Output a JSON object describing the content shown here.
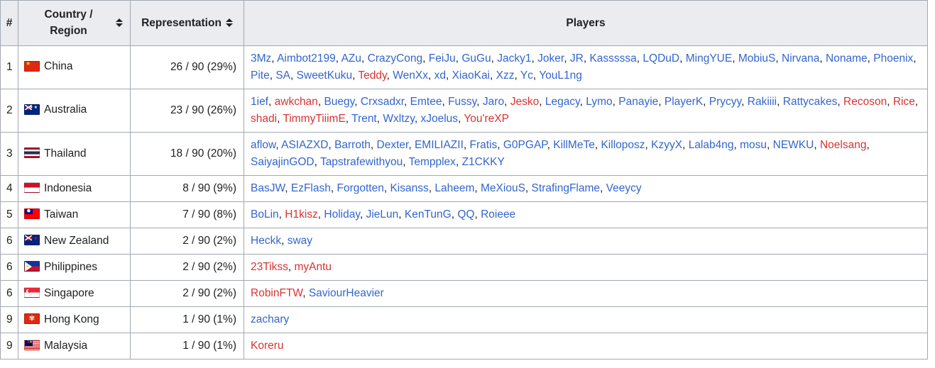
{
  "table": {
    "headers": [
      {
        "label": "#",
        "sortable": false,
        "name": "rank"
      },
      {
        "label": "Country / Region",
        "sortable": true,
        "name": "country-region"
      },
      {
        "label": "Representation",
        "sortable": true,
        "name": "representation"
      },
      {
        "label": "Players",
        "sortable": false,
        "name": "players"
      }
    ],
    "sort_icon": "sort-ascending-descending-icon",
    "colors": {
      "link_blue": "#3366cc",
      "link_red": "#d73333",
      "header_bg": "#eaecf0",
      "border": "#a2a9b1",
      "text": "#202122"
    },
    "rows": [
      {
        "rank": "1",
        "country": "China",
        "flag": "flag-china",
        "representation": "26 / 90 (29%)",
        "players": [
          {
            "name": "3Mz",
            "color": "blue"
          },
          {
            "name": "Aimbot2199",
            "color": "blue"
          },
          {
            "name": "AZu",
            "color": "blue"
          },
          {
            "name": "CrazyCong",
            "color": "blue"
          },
          {
            "name": "FeiJu",
            "color": "blue"
          },
          {
            "name": "GuGu",
            "color": "blue"
          },
          {
            "name": "Jacky1",
            "color": "blue"
          },
          {
            "name": "Joker",
            "color": "blue"
          },
          {
            "name": "JR",
            "color": "blue"
          },
          {
            "name": "Kasssssa",
            "color": "blue"
          },
          {
            "name": "LQDuD",
            "color": "blue"
          },
          {
            "name": "MingYUE",
            "color": "blue"
          },
          {
            "name": "MobiuS",
            "color": "blue"
          },
          {
            "name": "Nirvana",
            "color": "blue"
          },
          {
            "name": "Noname",
            "color": "blue"
          },
          {
            "name": "Phoenix",
            "color": "blue"
          },
          {
            "name": "Pite",
            "color": "blue"
          },
          {
            "name": "SA",
            "color": "blue"
          },
          {
            "name": "SweetKuku",
            "color": "blue"
          },
          {
            "name": "Teddy",
            "color": "red"
          },
          {
            "name": "WenXx",
            "color": "blue"
          },
          {
            "name": "xd",
            "color": "blue"
          },
          {
            "name": "XiaoKai",
            "color": "blue"
          },
          {
            "name": "Xzz",
            "color": "blue"
          },
          {
            "name": "Yc",
            "color": "blue"
          },
          {
            "name": "YouL1ng",
            "color": "blue"
          }
        ]
      },
      {
        "rank": "2",
        "country": "Australia",
        "flag": "flag-australia",
        "representation": "23 / 90 (26%)",
        "players": [
          {
            "name": "1ief",
            "color": "blue"
          },
          {
            "name": "awkchan",
            "color": "red"
          },
          {
            "name": "Buegy",
            "color": "blue"
          },
          {
            "name": "Crxsadxr",
            "color": "blue"
          },
          {
            "name": "Emtee",
            "color": "blue"
          },
          {
            "name": "Fussy",
            "color": "blue"
          },
          {
            "name": "Jaro",
            "color": "blue"
          },
          {
            "name": "Jesko",
            "color": "red"
          },
          {
            "name": "Legacy",
            "color": "blue"
          },
          {
            "name": "Lymo",
            "color": "blue"
          },
          {
            "name": "Panayie",
            "color": "blue"
          },
          {
            "name": "PlayerK",
            "color": "blue"
          },
          {
            "name": "Prycyy",
            "color": "blue"
          },
          {
            "name": "Rakiiii",
            "color": "blue"
          },
          {
            "name": "Rattycakes",
            "color": "blue"
          },
          {
            "name": "Recoson",
            "color": "red"
          },
          {
            "name": "Rice",
            "color": "red"
          },
          {
            "name": "shadi",
            "color": "red"
          },
          {
            "name": "TimmyTiiimE",
            "color": "red"
          },
          {
            "name": "Trent",
            "color": "blue"
          },
          {
            "name": "Wxltzy",
            "color": "blue"
          },
          {
            "name": "xJoelus",
            "color": "blue"
          },
          {
            "name": "You'reXP",
            "color": "red"
          }
        ]
      },
      {
        "rank": "3",
        "country": "Thailand",
        "flag": "flag-thailand",
        "representation": "18 / 90 (20%)",
        "players": [
          {
            "name": "aflow",
            "color": "blue"
          },
          {
            "name": "ASIAZXD",
            "color": "blue"
          },
          {
            "name": "Barroth",
            "color": "blue"
          },
          {
            "name": "Dexter",
            "color": "blue"
          },
          {
            "name": "EMILIAZII",
            "color": "blue"
          },
          {
            "name": "Fratis",
            "color": "blue"
          },
          {
            "name": "G0PGAP",
            "color": "blue"
          },
          {
            "name": "KillMeTe",
            "color": "blue"
          },
          {
            "name": "Killoposz",
            "color": "blue"
          },
          {
            "name": "KzyyX",
            "color": "blue"
          },
          {
            "name": "Lalab4ng",
            "color": "blue"
          },
          {
            "name": "mosu",
            "color": "blue"
          },
          {
            "name": "NEWKU",
            "color": "blue"
          },
          {
            "name": "Noelsang",
            "color": "red"
          },
          {
            "name": "SaiyajinGOD",
            "color": "blue"
          },
          {
            "name": "Tapstrafewithyou",
            "color": "blue"
          },
          {
            "name": "Tempplex",
            "color": "blue"
          },
          {
            "name": "Z1CKKY",
            "color": "blue"
          }
        ]
      },
      {
        "rank": "4",
        "country": "Indonesia",
        "flag": "flag-indonesia",
        "representation": "8 / 90 (9%)",
        "players": [
          {
            "name": "BasJW",
            "color": "blue"
          },
          {
            "name": "EzFlash",
            "color": "blue"
          },
          {
            "name": "Forgotten",
            "color": "blue"
          },
          {
            "name": "Kisanss",
            "color": "blue"
          },
          {
            "name": "Laheem",
            "color": "blue"
          },
          {
            "name": "MeXiouS",
            "color": "blue"
          },
          {
            "name": "StrafingFlame",
            "color": "blue"
          },
          {
            "name": "Veeycy",
            "color": "blue"
          }
        ]
      },
      {
        "rank": "5",
        "country": "Taiwan",
        "flag": "flag-taiwan",
        "representation": "7 / 90 (8%)",
        "players": [
          {
            "name": "BoLin",
            "color": "blue"
          },
          {
            "name": "H1kisz",
            "color": "red"
          },
          {
            "name": "Holiday",
            "color": "blue"
          },
          {
            "name": "JieLun",
            "color": "blue"
          },
          {
            "name": "KenTunG",
            "color": "blue"
          },
          {
            "name": "QQ",
            "color": "blue"
          },
          {
            "name": "Roieee",
            "color": "blue"
          }
        ]
      },
      {
        "rank": "6",
        "country": "New Zealand",
        "flag": "flag-new-zealand",
        "representation": "2 / 90 (2%)",
        "players": [
          {
            "name": "Heckk",
            "color": "blue"
          },
          {
            "name": "sway",
            "color": "blue"
          }
        ]
      },
      {
        "rank": "6",
        "country": "Philippines",
        "flag": "flag-philippines",
        "representation": "2 / 90 (2%)",
        "players": [
          {
            "name": "23Tikss",
            "color": "red"
          },
          {
            "name": "myAntu",
            "color": "red"
          }
        ]
      },
      {
        "rank": "6",
        "country": "Singapore",
        "flag": "flag-singapore",
        "representation": "2 / 90 (2%)",
        "players": [
          {
            "name": "RobinFTW",
            "color": "red"
          },
          {
            "name": "SaviourHeavier",
            "color": "blue"
          }
        ]
      },
      {
        "rank": "9",
        "country": "Hong Kong",
        "flag": "flag-hong-kong",
        "representation": "1 / 90 (1%)",
        "players": [
          {
            "name": "zachary",
            "color": "blue"
          }
        ]
      },
      {
        "rank": "9",
        "country": "Malaysia",
        "flag": "flag-malaysia",
        "representation": "1 / 90 (1%)",
        "players": [
          {
            "name": "Koreru",
            "color": "red"
          }
        ]
      }
    ]
  }
}
